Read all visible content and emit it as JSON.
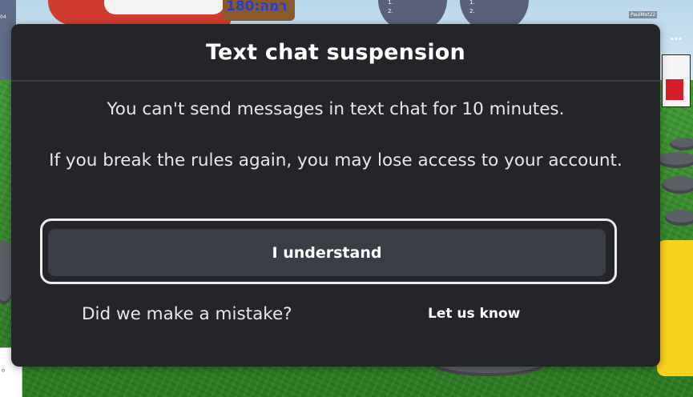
{
  "dialog": {
    "title": "Text chat suspension",
    "message": "You can't send messages in text chat for 10 minutes.",
    "warning": "If you break the rules again, you may lose access to your account.",
    "understand_label": "I understand",
    "mistake_text": "Did we make a mistake?",
    "let_us_know_label": "Let us know"
  },
  "background": {
    "sign_text": "180:רמה",
    "leaderboard_left": [
      "1.",
      "2."
    ],
    "leaderboard_right": [
      "1.",
      "2."
    ],
    "player_tag": "PaulMot22",
    "more_icon": "more-dots-icon",
    "side_number": "04"
  },
  "colors": {
    "dialog_bg": "#232529",
    "button_bg": "#3a3c46",
    "button_outline": "#ececec",
    "text": "#ffffff"
  }
}
